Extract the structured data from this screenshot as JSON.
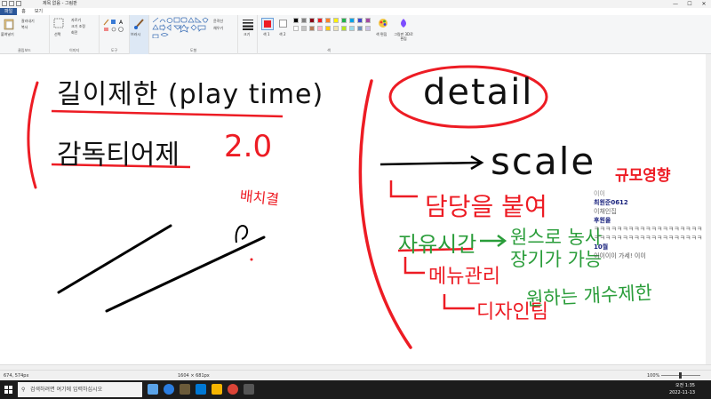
{
  "titlebar": {
    "title": "제목 없음 - 그림판",
    "min": "—",
    "max": "☐",
    "close": "✕"
  },
  "tabs": [
    {
      "label": "파일"
    },
    {
      "label": "홈"
    },
    {
      "label": "보기"
    }
  ],
  "ribbon": {
    "clipboard": {
      "paste": "붙여넣기",
      "cut": "잘라내기",
      "copy": "복사",
      "label": "클립보드"
    },
    "image": {
      "select": "선택",
      "crop": "자르기",
      "resize": "크기 조정",
      "rotate": "회전",
      "label": "이미지"
    },
    "tools": {
      "label": "도구"
    },
    "brushes": {
      "label": "브러시"
    },
    "shapes": {
      "outline": "윤곽선",
      "fill": "채우기",
      "label": "도형"
    },
    "size": {
      "label": "크기"
    },
    "colors": {
      "color1": "색 1",
      "color2": "색 2",
      "edit": "색 편집",
      "paint3d": "그림판 3D로 편집",
      "label": "색",
      "palette": [
        "#000000",
        "#7f7f7f",
        "#880015",
        "#ed1c24",
        "#ff7f27",
        "#fff200",
        "#22b14c",
        "#00a2e8",
        "#3f48cc",
        "#a349a4",
        "#ffffff",
        "#c3c3c3",
        "#b97a57",
        "#ffaec9",
        "#ffc90e",
        "#efe4b0",
        "#b5e61d",
        "#99d9ea",
        "#7092be",
        "#c8bfe7"
      ]
    }
  },
  "canvas": {
    "left": {
      "line1": "길이제한 (play time)",
      "line2": "감독티어제",
      "version": "2.0",
      "note": "배치결"
    },
    "right": {
      "detail": "detail",
      "scale": "scale",
      "scale_note": "규모영향",
      "staff": "담당을 붙여",
      "free_time": "자유시간",
      "free_time_note": "원스로 농사 장기가 가능",
      "menu": "메뉴관리",
      "design": "디자인팀",
      "design_note": "원하는 개수제한"
    }
  },
  "chat": [
    {
      "name": "이이",
      "color": "#888888"
    },
    {
      "name": "최원준0612",
      "color": "#1a237e"
    },
    {
      "name": "이채인집",
      "color": "#666666"
    },
    {
      "name": "후원을",
      "color": "#1a237e"
    },
    {
      "name": "ㅋㅋㅋㅋㅋㅋㅋㅋㅋㅋㅋㅋㅋㅋㅋㅋㅋㅋㅋ",
      "color": "#555555"
    },
    {
      "name": "ㅋㅋㅋㅋㅋㅋㅋㅋㅋㅋㅋㅋㅋㅋㅋㅋㅋㅋㅋ",
      "color": "#555555"
    },
    {
      "name": "10월",
      "color": "#1a237e"
    },
    {
      "name": "이이이이 가세! 이이",
      "color": "#555555"
    }
  ],
  "status": {
    "position": "674, 574px",
    "size": "1604 × 681px",
    "zoom": "100%"
  },
  "taskbar": {
    "search_placeholder": "검색하려면 여기에 입력하십시오",
    "time": "오전 1:35",
    "date": "2022-11-13"
  }
}
